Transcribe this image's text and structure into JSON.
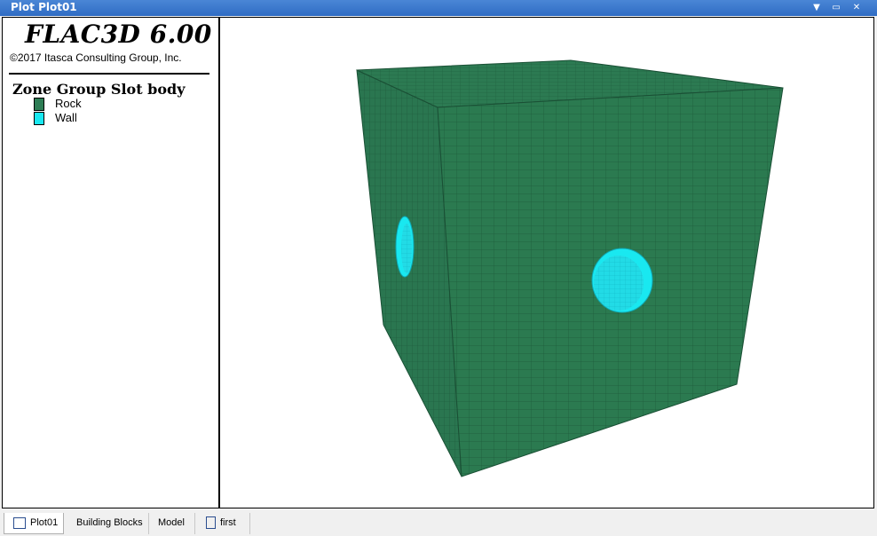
{
  "window": {
    "title": "Plot Plot01"
  },
  "legend": {
    "app_title": "FLAC3D 6.00",
    "copyright": "©2017 Itasca Consulting Group, Inc.",
    "group_title": "Zone Group Slot body",
    "items": [
      {
        "label": "Rock",
        "color": "#2e7d55"
      },
      {
        "label": "Wall",
        "color": "#19e8f0"
      }
    ]
  },
  "tabs": [
    {
      "label": "Plot01",
      "icon": "plot-icon"
    },
    {
      "label": "Building Blocks"
    },
    {
      "label": "Model"
    },
    {
      "label": "first",
      "icon": "document-icon"
    }
  ],
  "colors": {
    "rock": "#2b7a50",
    "wall": "#19e8f0",
    "titlebar": "#3a78cc"
  }
}
